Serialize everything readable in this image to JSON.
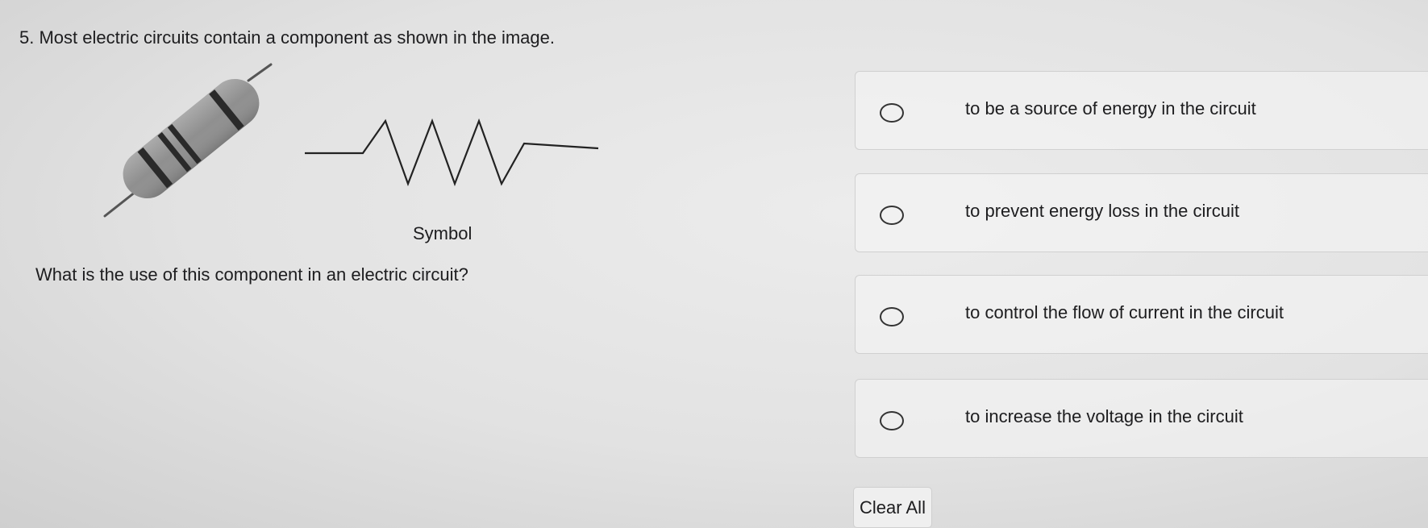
{
  "question": {
    "text": "5. Most electric circuits contain a component as shown in the image.",
    "symbol_caption": "Symbol",
    "sub_question": "What is the use of this component in an electric circuit?"
  },
  "options": [
    {
      "label": "to be a source of energy in the circuit",
      "selected": false
    },
    {
      "label": "to prevent energy loss in the circuit",
      "selected": false
    },
    {
      "label": "to control the flow of current in the circuit",
      "selected": false
    },
    {
      "label": "to increase the voltage in the circuit",
      "selected": false
    }
  ],
  "controls": {
    "clear_label": "Clear All"
  },
  "colors": {
    "resistor_body": "#8f8f8f",
    "resistor_band": "#2a2a2a",
    "symbol_line": "#222222"
  }
}
